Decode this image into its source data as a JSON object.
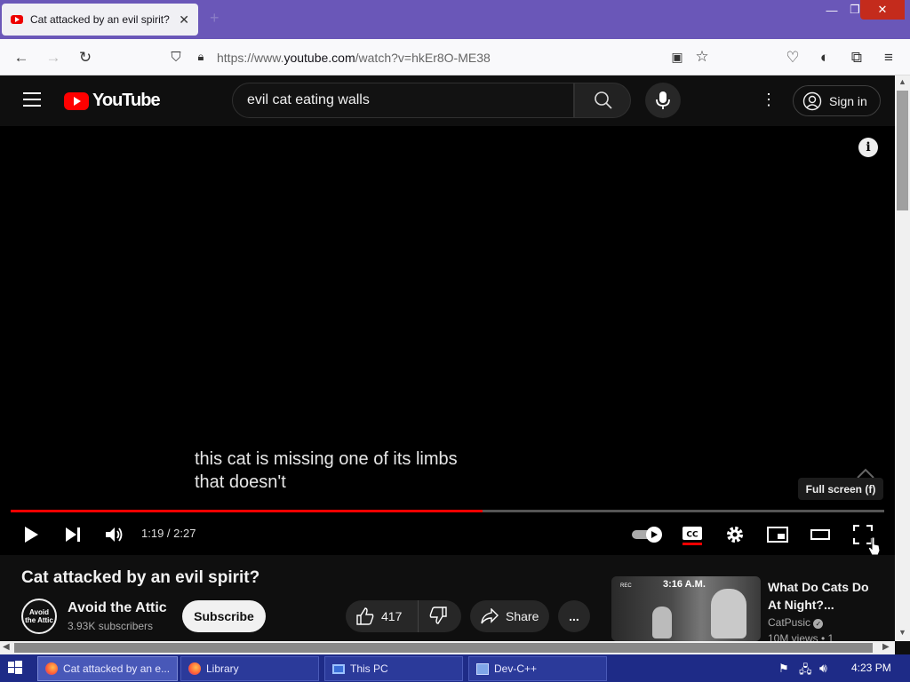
{
  "browser": {
    "tab_title": "Cat attacked by an evil spirit? -",
    "new_tab_symbol": "+",
    "url_prefix": "https://www.",
    "url_domain": "youtube.com",
    "url_path": "/watch?v=hkEr8O-ME38"
  },
  "youtube": {
    "logo_text": "YouTube",
    "search_query": "evil cat eating walls",
    "sign_in_label": "Sign in"
  },
  "player": {
    "caption_line1": "this cat is missing one of its limbs",
    "caption_line2": "that doesn't",
    "tooltip": "Full screen (f)",
    "timecode": "1:19 / 2:27",
    "progress": 0.54
  },
  "video": {
    "title": "Cat attacked by an evil spirit?",
    "channel": "Avoid the Attic",
    "avatar_text": "Avoid the Attic",
    "subscribers": "3.93K subscribers",
    "subscribe_label": "Subscribe",
    "likes": "417",
    "share_label": "Share",
    "more_label": "..."
  },
  "recommendation": {
    "title": "What Do Cats Do At Night?...",
    "channel": "CatPusic",
    "views": "10M views • 1",
    "thumb_time": "3:16 A.M.",
    "thumb_rec": "REC"
  },
  "taskbar": {
    "items": [
      {
        "label": "Cat attacked by an e..."
      },
      {
        "label": "Library"
      },
      {
        "label": "This PC"
      },
      {
        "label": "Dev-C++"
      }
    ],
    "clock": "4:23 PM"
  }
}
